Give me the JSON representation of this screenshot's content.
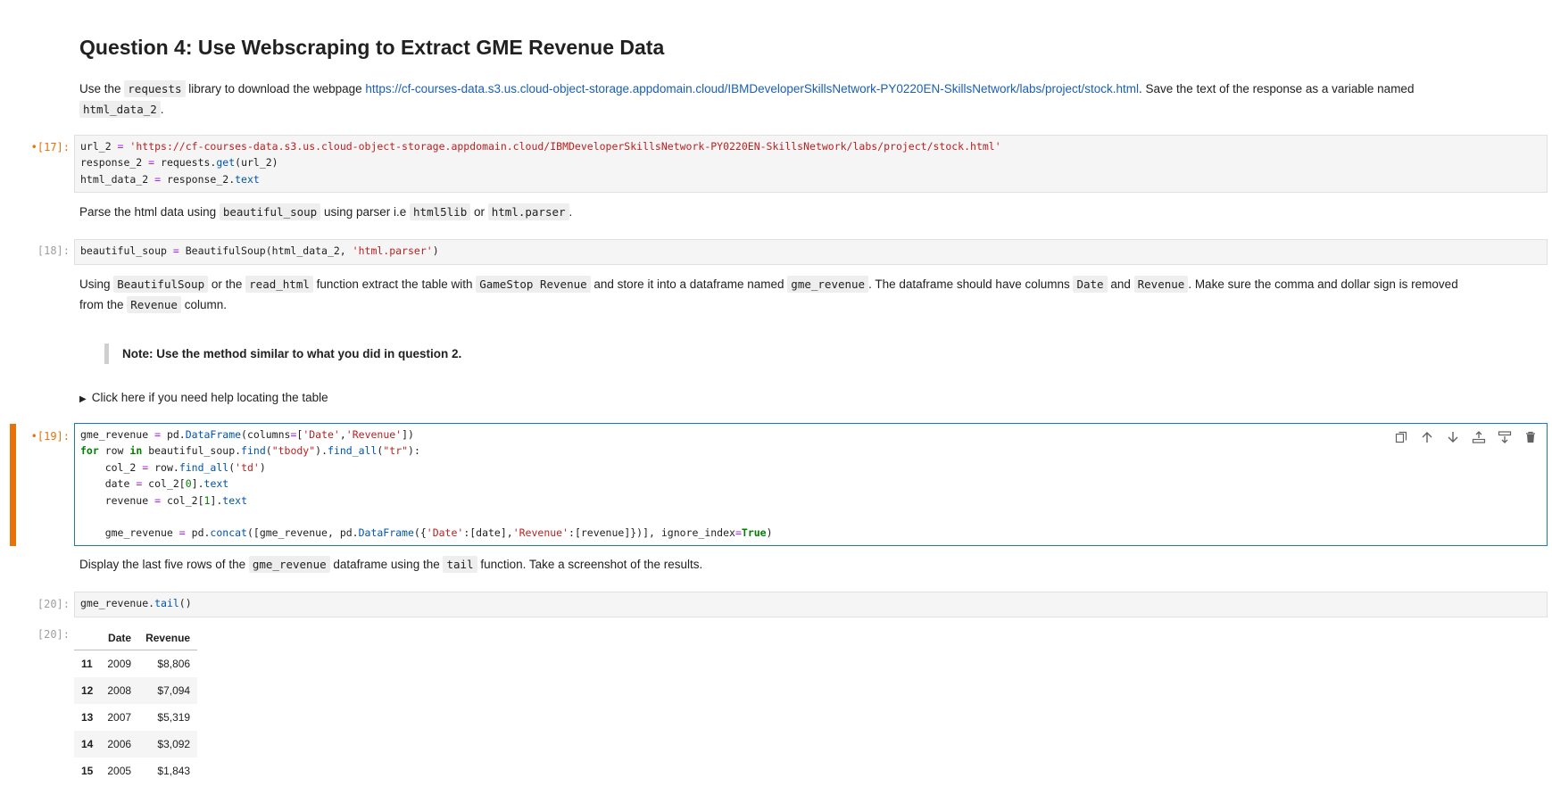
{
  "heading": "Question 4: Use Webscraping to Extract GME Revenue Data",
  "p1": {
    "before": "Use the ",
    "code1": "requests",
    "mid": " library to download the webpage ",
    "link": "https://cf-courses-data.s3.us.cloud-object-storage.appdomain.cloud/IBMDeveloperSkillsNetwork-PY0220EN-SkillsNetwork/labs/project/stock.html",
    "after": ". Save the text of the response as a variable named",
    "code2": "html_data_2",
    "end": "."
  },
  "cell17": {
    "prompt": "•[17]:",
    "lines": [
      "url_2 = 'https://cf-courses-data.s3.us.cloud-object-storage.appdomain.cloud/IBMDeveloperSkillsNetwork-PY0220EN-SkillsNetwork/labs/project/stock.html'",
      "response_2 = requests.get(url_2)",
      "html_data_2 = response_2.text"
    ]
  },
  "p2": {
    "before": "Parse the html data using ",
    "code1": "beautiful_soup",
    "mid": " using parser i.e ",
    "code2": "html5lib",
    "or": " or ",
    "code3": "html.parser",
    "end": "."
  },
  "cell18": {
    "prompt": "[18]:",
    "line": "beautiful_soup = BeautifulSoup(html_data_2, 'html.parser')"
  },
  "p3": {
    "t1": "Using ",
    "c1": "BeautifulSoup",
    "t2": " or the ",
    "c2": "read_html",
    "t3": " function extract the table with ",
    "c3": "GameStop Revenue",
    "t4": " and store it into a dataframe named ",
    "c4": "gme_revenue",
    "t5": ". The dataframe should have columns ",
    "c5": "Date",
    "t6": " and ",
    "c6": "Revenue",
    "t7": ". Make sure the comma and dollar sign is removed",
    "t8": "from the ",
    "c7": "Revenue",
    "t9": " column."
  },
  "note": "Note: Use the method similar to what you did in question 2.",
  "details": "Click here if you need help locating the table",
  "cell19": {
    "prompt": "•[19]:",
    "lines": [
      "gme_revenue = pd.DataFrame(columns=['Date','Revenue'])",
      "for row in beautiful_soup.find(\"tbody\").find_all(\"tr\"):",
      "    col_2 = row.find_all('td')",
      "    date = col_2[0].text",
      "    revenue = col_2[1].text",
      "",
      "    gme_revenue = pd.concat([gme_revenue, pd.DataFrame({'Date':[date],'Revenue':[revenue]})], ignore_index=True)"
    ]
  },
  "toolbar": {
    "icons": [
      "duplicate-icon",
      "move-up-icon",
      "move-down-icon",
      "insert-above-icon",
      "insert-below-icon",
      "delete-icon"
    ]
  },
  "p4": {
    "t1": "Display the last five rows of the ",
    "c1": "gme_revenue",
    "t2": " dataframe using the ",
    "c2": "tail",
    "t3": " function. Take a screenshot of the results."
  },
  "cell20": {
    "prompt": "[20]:",
    "line": "gme_revenue.tail()",
    "out_prompt": "[20]:"
  },
  "table": {
    "headers": [
      "",
      "Date",
      "Revenue"
    ],
    "rows": [
      [
        "11",
        "2009",
        "$8,806"
      ],
      [
        "12",
        "2008",
        "$7,094"
      ],
      [
        "13",
        "2007",
        "$5,319"
      ],
      [
        "14",
        "2006",
        "$3,092"
      ],
      [
        "15",
        "2005",
        "$1,843"
      ]
    ]
  }
}
